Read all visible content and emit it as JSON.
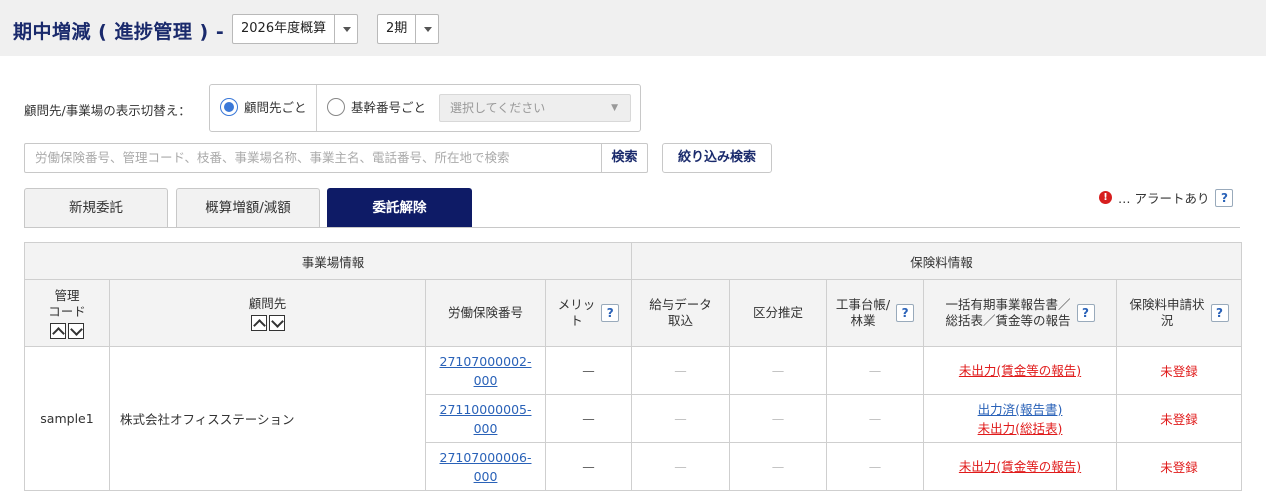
{
  "header": {
    "title": "期中増減 ( 進捗管理 ) -",
    "year_select": "2026年度概算",
    "period_select": "2期"
  },
  "switch": {
    "label": "顧問先/事業場の表示切替え：",
    "option_client": "顧問先ごと",
    "option_base": "基幹番号ごと",
    "select_placeholder": "選択してください"
  },
  "search": {
    "placeholder": "労働保険番号、管理コード、枝番、事業場名称、事業主名、電話番号、所在地で検索",
    "search_label": "検索",
    "filter_label": "絞り込み検索"
  },
  "tabs": [
    {
      "label": "新規委託"
    },
    {
      "label": "概算増額/減額"
    },
    {
      "label": "委託解除"
    }
  ],
  "alert": {
    "text": "… アラートあり",
    "help": "?"
  },
  "table": {
    "section_left": "事業場情報",
    "section_right": "保険料情報",
    "headers": {
      "code_1": "管理",
      "code_2": "コード",
      "client": "顧問先",
      "ins_no": "労働保険番号",
      "merit_1": "メリッ",
      "merit_2": "ト",
      "salary_1": "給与データ",
      "salary_2": "取込",
      "class": "区分推定",
      "ledger_1": "工事台帳/",
      "ledger_2": "林業",
      "report_1": "一括有期事業報告書／",
      "report_2": "総括表／賃金等の報告",
      "apply_1": "保険料申請状",
      "apply_2": "況"
    },
    "group": {
      "code": "sample1",
      "client": "株式会社オフィスステーション"
    },
    "rows": [
      {
        "ins_a": "27107000002-",
        "ins_b": "000",
        "merit": "—",
        "salary": "—",
        "class": "—",
        "ledger": "—",
        "report_1": "未出力(賃金等の報告)",
        "report_2": "",
        "apply": "未登録"
      },
      {
        "ins_a": "27110000005-",
        "ins_b": "000",
        "merit": "—",
        "salary": "—",
        "class": "—",
        "ledger": "—",
        "report_1": "出力済(報告書)",
        "report_2": "未出力(総括表)",
        "apply": "未登録"
      },
      {
        "ins_a": "27107000006-",
        "ins_b": "000",
        "merit": "—",
        "salary": "—",
        "class": "—",
        "ledger": "—",
        "report_1": "未出力(賃金等の報告)",
        "report_2": "",
        "apply": "未登録"
      }
    ]
  }
}
